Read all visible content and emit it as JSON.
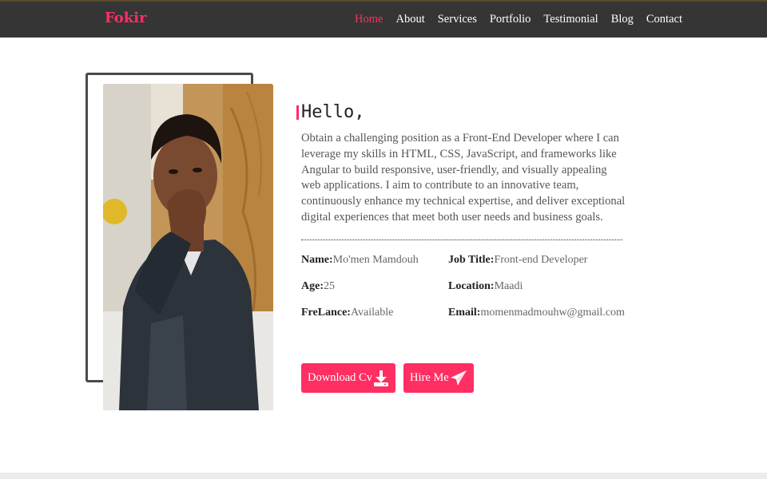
{
  "navbar": {
    "brand": "Fokir",
    "links": [
      {
        "label": "Home",
        "active": true
      },
      {
        "label": "About",
        "active": false
      },
      {
        "label": "Services",
        "active": false
      },
      {
        "label": "Portfolio",
        "active": false
      },
      {
        "label": "Testimonial",
        "active": false
      },
      {
        "label": "Blog",
        "active": false
      },
      {
        "label": "Contact",
        "active": false
      }
    ]
  },
  "about": {
    "greeting": "Hello,",
    "intro": "Obtain a challenging position as a Front-End Developer where I can leverage my skills in HTML, CSS, JavaScript, and frameworks like Angular to build responsive, user-friendly, and visually appealing web applications. I aim to contribute to an innovative team, continuously enhance my technical expertise, and deliver exceptional digital experiences that meet both user needs and business goals.",
    "info": {
      "name": {
        "label": "Name:",
        "value": "Mo'men Mamdouh"
      },
      "job_title": {
        "label": "Job Title:",
        "value": "Front-end Developer"
      },
      "age": {
        "label": "Age:",
        "value": "25"
      },
      "location": {
        "label": "Location:",
        "value": "Maadi"
      },
      "freelance": {
        "label": "FreLance:",
        "value": "Available"
      },
      "email": {
        "label": "Email:",
        "value": "momenmadmouhw@gmail.com"
      }
    },
    "buttons": {
      "download_cv": "Download Cv",
      "hire_me": "Hire Me"
    }
  },
  "colors": {
    "accent": "#ff2e63",
    "navbar_bg": "#353535",
    "text_dark": "#222222",
    "text_muted": "#555555"
  },
  "icons": {
    "download": "download-icon",
    "hire": "paper-plane-icon"
  }
}
